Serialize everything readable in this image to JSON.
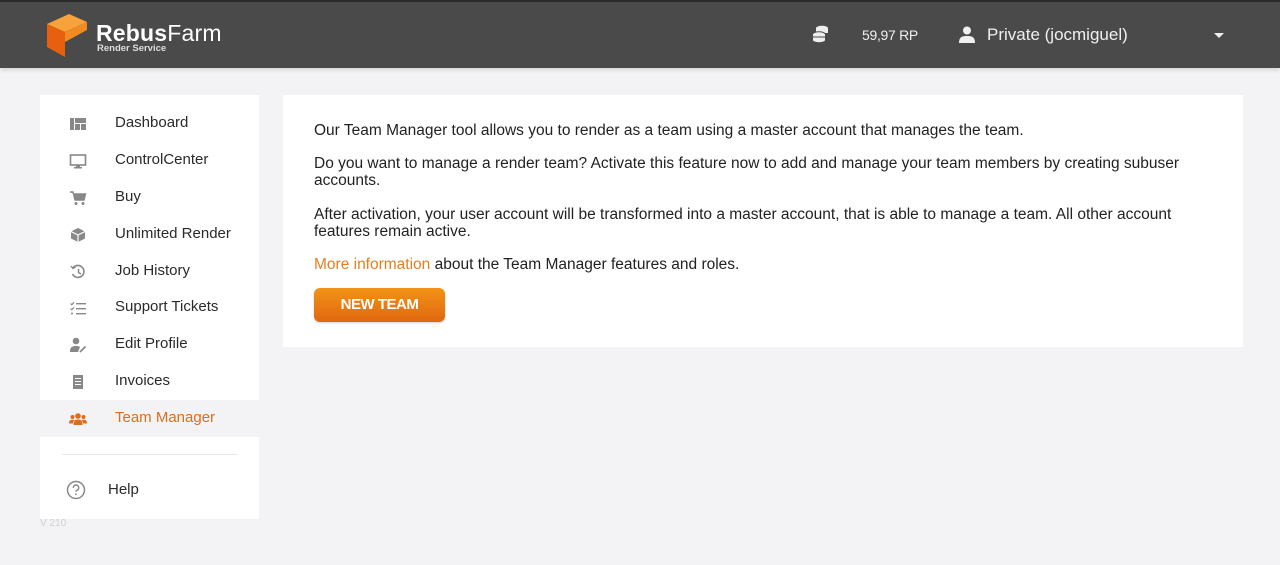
{
  "header": {
    "logo_brand_bold": "Rebus",
    "logo_brand_light": "Farm",
    "logo_subtitle": "Render Service",
    "credits": "59,97 RP",
    "user": "Private (jocmiguel)"
  },
  "sidebar": {
    "items": [
      {
        "label": "Dashboard",
        "icon": "dashboard-icon"
      },
      {
        "label": "ControlCenter",
        "icon": "monitor-icon"
      },
      {
        "label": "Buy",
        "icon": "cart-icon"
      },
      {
        "label": "Unlimited Render",
        "icon": "cube-icon"
      },
      {
        "label": "Job History",
        "icon": "history-icon"
      },
      {
        "label": "Support Tickets",
        "icon": "checklist-icon"
      },
      {
        "label": "Edit Profile",
        "icon": "user-edit-icon"
      },
      {
        "label": "Invoices",
        "icon": "receipt-icon"
      },
      {
        "label": "Team Manager",
        "icon": "team-icon",
        "active": true
      }
    ],
    "help": "Help",
    "version": "V 210"
  },
  "main": {
    "p1": "Our Team Manager tool allows you to render as a team using a master account that manages the team.",
    "p2": "Do you want to manage a render team? Activate this feature now to add and manage your team members by creating subuser accounts.",
    "p3": "After activation, your user account will be transformed into a master account, that is able to manage a team. All other account features remain active.",
    "p4_link": "More information",
    "p4_rest": " about the Team Manager features and roles.",
    "button": "NEW TEAM"
  },
  "colors": {
    "accent": "#e67e22",
    "header_bg": "#4a4a4a",
    "page_bg": "#f3f3f5"
  }
}
